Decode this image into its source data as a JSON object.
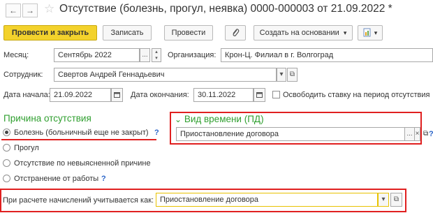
{
  "nav": {
    "back_glyph": "←",
    "forward_glyph": "→",
    "star_glyph": "☆"
  },
  "title": "Отсутствие (болезнь, прогул, неявка) 0000-000003 от 21.09.2022 *",
  "toolbar": {
    "post_close": "Провести и закрыть",
    "save": "Записать",
    "post": "Провести",
    "attach_icon": "paperclip-icon",
    "create_based": "Создать на основании",
    "dropdown_glyph": "▾",
    "report_icon": "report-icon"
  },
  "fields": {
    "month_label": "Месяц:",
    "month_value": "Сентябрь 2022",
    "org_label": "Организация:",
    "org_value": "Крон-Ц. Филиал в г. Волгоград",
    "employee_label": "Сотрудник:",
    "employee_value": "Свертов Андрей Геннадьевич",
    "start_label": "Дата начала:",
    "start_value": "21.09.2022",
    "end_label": "Дата окончания:",
    "end_value": "30.11.2022",
    "free_rate_label": "Освободить ставку на период отсутствия"
  },
  "reason": {
    "title": "Причина отсутствия",
    "options": [
      {
        "label": "Болезнь (больничный еще не закрыт)",
        "selected": true,
        "help": "?"
      },
      {
        "label": "Прогул",
        "selected": false
      },
      {
        "label": "Отсутствие по невыясненной причине",
        "selected": false
      },
      {
        "label": "Отстранение от работы",
        "selected": false,
        "help": "?"
      }
    ]
  },
  "time_kind": {
    "title": "Вид времени (ПД)",
    "value": "Приостановление договора",
    "help": "?"
  },
  "calc": {
    "label": "При расчете начислений учитывается как:",
    "value": "Приостановление договора"
  },
  "glyphs": {
    "ellipsis": "...",
    "clear": "×",
    "open": "⧉",
    "spin_up": "▴",
    "spin_down": "▾",
    "chevron": "⌄"
  },
  "colors": {
    "accent_yellow": "#f3d22c",
    "highlight_red": "#e02020",
    "group_green": "#2f9f2f",
    "help_blue": "#2a64c8"
  }
}
